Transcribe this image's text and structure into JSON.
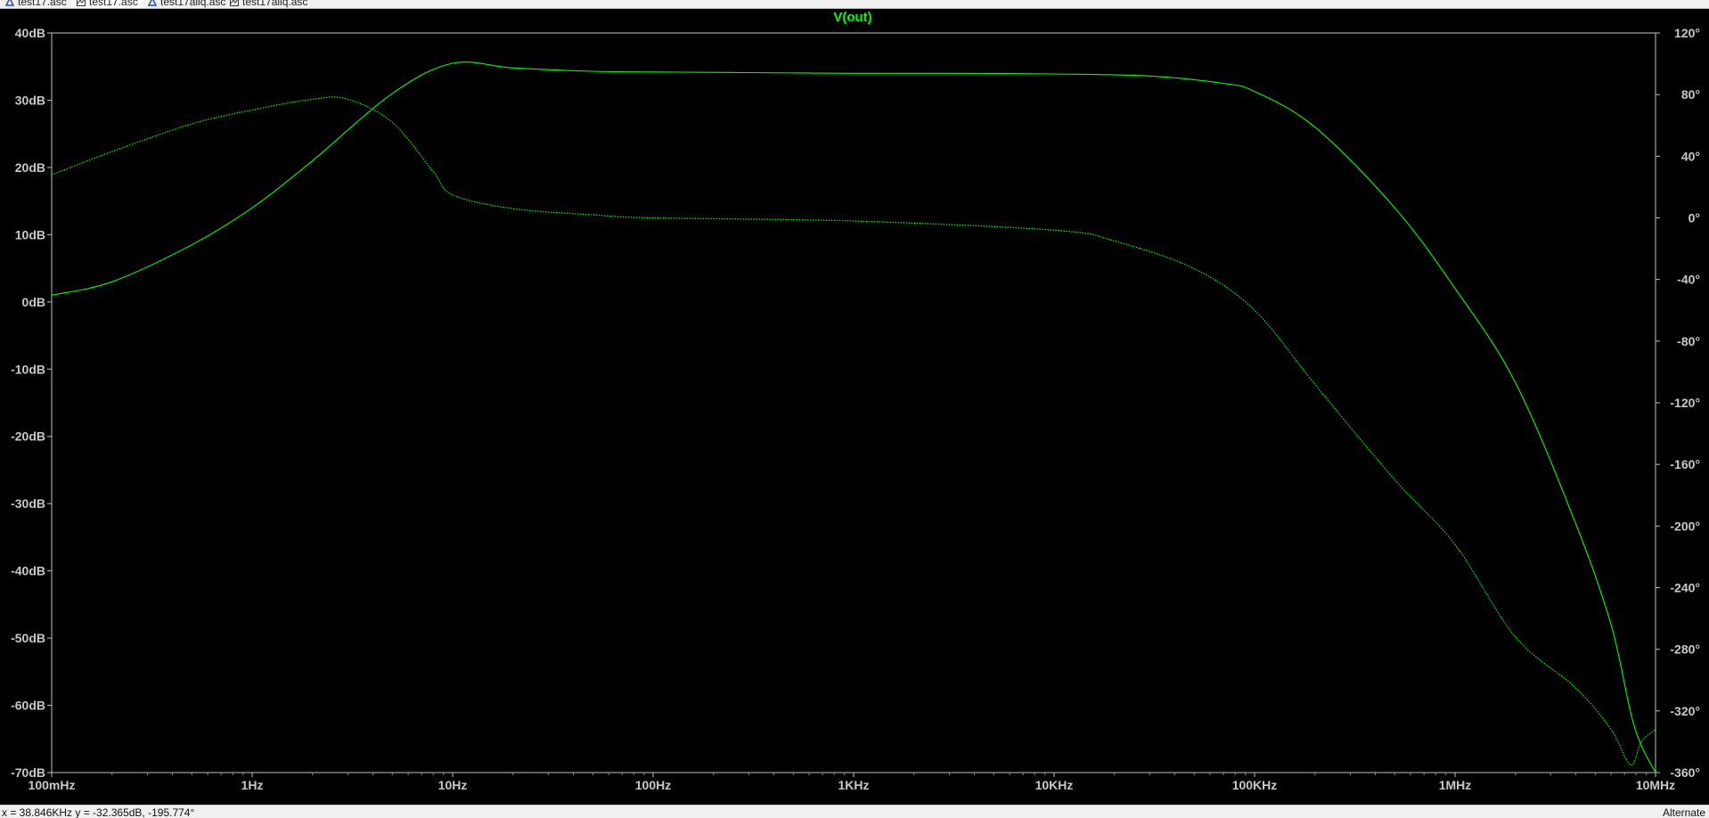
{
  "tabs": [
    {
      "label": "test17.asc",
      "icon": "schematic-icon",
      "active": false
    },
    {
      "label": "test17.asc",
      "icon": "waveform-icon",
      "active": true
    },
    {
      "label": "test17aiiq.asc",
      "icon": "schematic-icon",
      "active": false
    },
    {
      "label": "test17aiiq.asc",
      "icon": "waveform-icon",
      "active": false
    }
  ],
  "status": {
    "cursor_readout": "x = 38.846KHz    y = -32.365dB, -195.774°",
    "mode": "Alternate"
  },
  "colors": {
    "background": "#000000",
    "trace": "#00ff00",
    "axis_text": "#c8c8c8",
    "title": "#00ff00",
    "frame": "#c0c0c0"
  },
  "chart_data": {
    "type": "line",
    "title": "V(out)",
    "x_scale": "log",
    "xlim": [
      0.1,
      10000000
    ],
    "x_ticks": [
      {
        "value": 0.1,
        "label": "100mHz"
      },
      {
        "value": 1,
        "label": "1Hz"
      },
      {
        "value": 10,
        "label": "10Hz"
      },
      {
        "value": 100,
        "label": "100Hz"
      },
      {
        "value": 1000,
        "label": "1KHz"
      },
      {
        "value": 10000,
        "label": "10KHz"
      },
      {
        "value": 100000,
        "label": "100KHz"
      },
      {
        "value": 1000000,
        "label": "1MHz"
      },
      {
        "value": 10000000,
        "label": "10MHz"
      }
    ],
    "y_left": {
      "unit": "dB",
      "ylim": [
        -70,
        40
      ],
      "ticks": [
        40,
        30,
        20,
        10,
        0,
        -10,
        -20,
        -30,
        -40,
        -50,
        -60,
        -70
      ],
      "labels": [
        "40dB",
        "30dB",
        "20dB",
        "10dB",
        "0dB",
        "-10dB",
        "-20dB",
        "-30dB",
        "-40dB",
        "-50dB",
        "-60dB",
        "-70dB"
      ]
    },
    "y_right": {
      "unit": "°",
      "ylim": [
        -360,
        120
      ],
      "ticks": [
        120,
        80,
        40,
        0,
        -40,
        -80,
        -120,
        -160,
        -200,
        -240,
        -280,
        -320,
        -360
      ],
      "labels": [
        "120°",
        "80°",
        "40°",
        "0°",
        "-40°",
        "-80°",
        "-120°",
        "-160°",
        "-200°",
        "-240°",
        "-280°",
        "-320°",
        "-360°"
      ]
    },
    "series": [
      {
        "style": "solid",
        "axis": "left",
        "x": [
          0.1,
          0.2,
          0.5,
          1,
          2,
          5,
          10,
          20,
          50,
          100,
          300,
          1000,
          3000,
          10000,
          30000,
          70000,
          100000,
          200000,
          500000,
          1000000,
          2000000,
          4000000,
          6000000,
          7500000,
          8500000,
          10000000
        ],
        "y": [
          1.0,
          3.0,
          8.5,
          14.0,
          21.0,
          31.0,
          35.5,
          34.8,
          34.3,
          34.2,
          34.1,
          34.0,
          34.0,
          33.9,
          33.6,
          32.5,
          31.3,
          26.0,
          14.0,
          2.0,
          -12.0,
          -33.0,
          -48.0,
          -61.0,
          -66.0,
          -70.0
        ]
      },
      {
        "style": "dotted",
        "axis": "right",
        "x": [
          0.1,
          0.2,
          0.5,
          1,
          2,
          3,
          5,
          8,
          10,
          20,
          50,
          100,
          1000,
          10000,
          20000,
          50000,
          100000,
          200000,
          500000,
          1000000,
          2000000,
          4000000,
          6000000,
          7500000,
          8500000,
          10000000
        ],
        "y": [
          28,
          43,
          61,
          70,
          77,
          77,
          62,
          30,
          15,
          6,
          2,
          0,
          -2,
          -8,
          -15,
          -33,
          -60,
          -108,
          -170,
          -212,
          -272,
          -305,
          -332,
          -355,
          -340,
          -332
        ]
      }
    ]
  }
}
